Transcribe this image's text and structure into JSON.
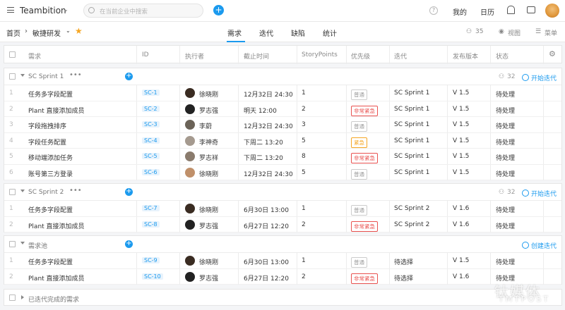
{
  "topbar": {
    "brand": "Teambition",
    "search_placeholder": "在当前企业中搜索",
    "nav": [
      "我的",
      "日历"
    ]
  },
  "subbar": {
    "crumb_home": "首页",
    "crumb_project": "敏捷研发",
    "tabs": [
      "需求",
      "迭代",
      "缺陷",
      "统计"
    ],
    "active_tab": "需求",
    "member_count": "35",
    "view_label": "视图",
    "menu_label": "菜单"
  },
  "columns": [
    "需求",
    "ID",
    "执行者",
    "截止时间",
    "StoryPoints",
    "优先级",
    "迭代",
    "发布版本",
    "状态"
  ],
  "groups": [
    {
      "title": "SC Sprint 1",
      "count": "32",
      "action": "开始迭代",
      "rows": [
        {
          "idx": "1",
          "title": "任务多字段配置",
          "id": "SC-1",
          "assignee": "徐晓刚",
          "due": "12月32日 24:30",
          "points": "1",
          "priority": "普通",
          "ptype": "normal",
          "sprint": "SC Sprint 1",
          "version": "V 1.5",
          "status": "待处理",
          "av": "#3a2c22"
        },
        {
          "idx": "2",
          "title": "Plant 直接添加成员",
          "id": "SC-2",
          "assignee": "罗志强",
          "due": "明天 12:00",
          "points": "2",
          "priority": "非常紧急",
          "ptype": "urgent",
          "sprint": "SC Sprint 1",
          "version": "V 1.5",
          "status": "待处理",
          "av": "#222"
        },
        {
          "idx": "3",
          "title": "字段拖拽排序",
          "id": "SC-3",
          "assignee": "李蔚",
          "due": "12月32日 24:30",
          "points": "3",
          "priority": "普通",
          "ptype": "normal",
          "sprint": "SC Sprint 1",
          "version": "V 1.5",
          "status": "待处理",
          "av": "#6b6358"
        },
        {
          "idx": "4",
          "title": "字段任务配置",
          "id": "SC-4",
          "assignee": "李神奇",
          "due": "下周二 13:20",
          "points": "5",
          "priority": "紧急",
          "ptype": "warn",
          "sprint": "SC Sprint 1",
          "version": "V 1.5",
          "status": "待处理",
          "av": "#a59a8f"
        },
        {
          "idx": "5",
          "title": "移动端添加任务",
          "id": "SC-5",
          "assignee": "罗志祥",
          "due": "下周二 13:20",
          "points": "8",
          "priority": "非常紧急",
          "ptype": "urgent",
          "sprint": "SC Sprint 1",
          "version": "V 1.5",
          "status": "待处理",
          "av": "#8a7b6d"
        },
        {
          "idx": "6",
          "title": "账号第三方登录",
          "id": "SC-6",
          "assignee": "徐晓刚",
          "due": "12月32日 24:30",
          "points": "5",
          "priority": "普通",
          "ptype": "normal",
          "sprint": "SC Sprint 1",
          "version": "V 1.5",
          "status": "待处理",
          "av": "#c0906a"
        }
      ]
    },
    {
      "title": "SC Sprint 2",
      "count": "32",
      "action": "开始迭代",
      "rows": [
        {
          "idx": "1",
          "title": "任务多字段配置",
          "id": "SC-7",
          "assignee": "徐晓刚",
          "due": "6月30日 13:00",
          "points": "1",
          "priority": "普通",
          "ptype": "normal",
          "sprint": "SC Sprint 2",
          "version": "V 1.6",
          "status": "待处理",
          "av": "#3a2c22"
        },
        {
          "idx": "2",
          "title": "Plant 直接添加成员",
          "id": "SC-8",
          "assignee": "罗志强",
          "due": "6月27日 12:20",
          "points": "2",
          "priority": "非常紧急",
          "ptype": "urgent",
          "sprint": "SC Sprint 2",
          "version": "V 1.6",
          "status": "待处理",
          "av": "#222"
        }
      ]
    },
    {
      "title": "需求池",
      "count": "",
      "action": "创建迭代",
      "rows": [
        {
          "idx": "1",
          "title": "任务多字段配置",
          "id": "SC-9",
          "assignee": "徐晓刚",
          "due": "6月30日 13:00",
          "points": "1",
          "priority": "普通",
          "ptype": "normal",
          "sprint": "待选择",
          "version": "V 1.5",
          "status": "待处理",
          "av": "#3a2c22"
        },
        {
          "idx": "2",
          "title": "Plant 直接添加成员",
          "id": "SC-10",
          "assignee": "罗志强",
          "due": "6月27日 12:20",
          "points": "2",
          "priority": "非常紧急",
          "ptype": "urgent",
          "sprint": "待选择",
          "version": "V 1.6",
          "status": "待处理",
          "av": "#222"
        }
      ]
    }
  ],
  "completed_group": "已迭代完成的需求",
  "watermark": [
    "钛媒体",
    "TMTPOST"
  ]
}
